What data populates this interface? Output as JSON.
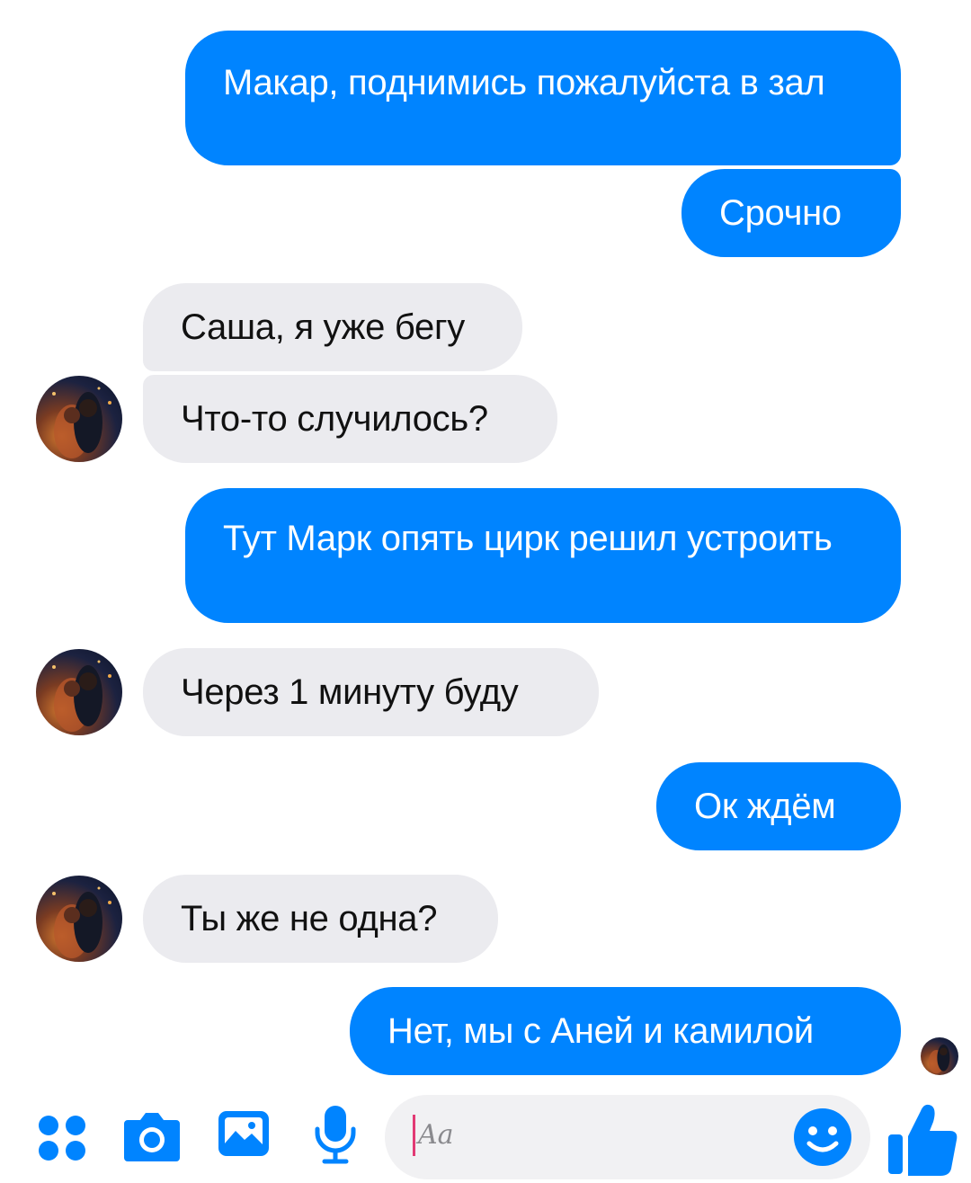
{
  "messages": [
    {
      "id": "m1",
      "dir": "out",
      "text": "Макар, поднимись пожалуйста в зал"
    },
    {
      "id": "m2",
      "dir": "out",
      "text": "Срочно"
    },
    {
      "id": "m3",
      "dir": "in",
      "text": "Саша, я уже бегу"
    },
    {
      "id": "m4",
      "dir": "in",
      "text": "Что-то случилось?"
    },
    {
      "id": "m5",
      "dir": "out",
      "text": "Тут Марк опять цирк решил устроить"
    },
    {
      "id": "m6",
      "dir": "in",
      "text": "Через 1 минуту буду"
    },
    {
      "id": "m7",
      "dir": "out",
      "text": "Ок ждём"
    },
    {
      "id": "m8",
      "dir": "in",
      "text": "Ты же не одна?"
    },
    {
      "id": "m9",
      "dir": "out",
      "text": "Нет, мы с Аней и камилой"
    }
  ],
  "composer": {
    "placeholder": "Aa",
    "icons": [
      "menu-dots-icon",
      "camera-icon",
      "gallery-icon",
      "microphone-icon",
      "emoji-icon",
      "like-thumb-icon"
    ]
  },
  "colors": {
    "outgoing_bubble": "#0084ff",
    "incoming_bubble": "#ebebef",
    "accent": "#0084ff"
  }
}
